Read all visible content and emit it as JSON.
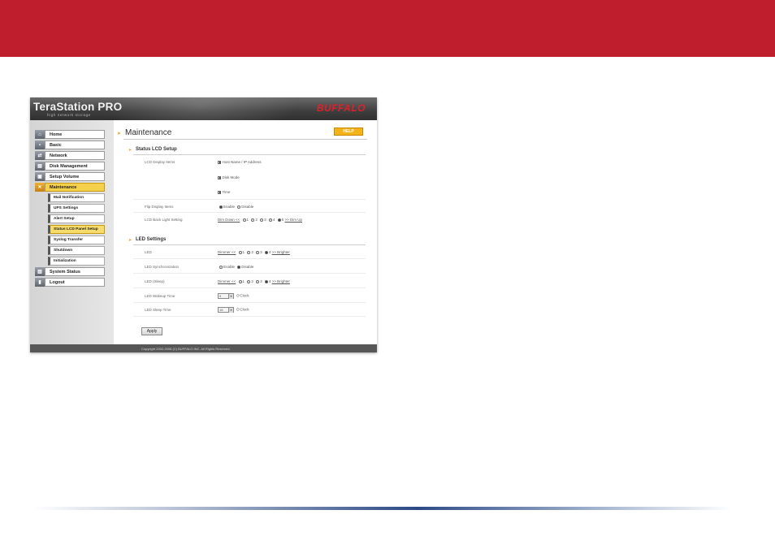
{
  "app": {
    "product_name": "TeraStation PRO",
    "product_sub": "high network storage",
    "brand": "BUFFALO"
  },
  "sidebar": {
    "items": [
      {
        "label": "Home",
        "icon": "home-icon"
      },
      {
        "label": "Basic",
        "icon": "basic-icon"
      },
      {
        "label": "Network",
        "icon": "network-icon"
      },
      {
        "label": "Disk Management",
        "icon": "disk-icon"
      },
      {
        "label": "Setup Volume",
        "icon": "volume-icon"
      },
      {
        "label": "Maintenance",
        "icon": "tools-icon"
      }
    ],
    "sub_items": [
      {
        "label": "Mail Notification"
      },
      {
        "label": "UPS Settings"
      },
      {
        "label": "Alert Setup"
      },
      {
        "label": "Status LCD Panel Setup"
      },
      {
        "label": "Syslog Transfer"
      },
      {
        "label": "Shutdown"
      },
      {
        "label": "Initialization"
      }
    ],
    "bottom_items": [
      {
        "label": "System Status",
        "icon": "status-icon"
      },
      {
        "label": "Logout",
        "icon": "logout-icon"
      }
    ]
  },
  "main": {
    "title": "Maintenance",
    "help_label": "HELP",
    "status_lcd": {
      "heading": "Status LCD Setup",
      "display_items_label": "LCD Display Items",
      "display_items": [
        {
          "label": "Host Name / IP Address",
          "checked": true
        },
        {
          "label": "Disk Mode",
          "checked": true
        },
        {
          "label": "Time",
          "checked": true
        }
      ],
      "flip_label": "Flip Display Items",
      "flip_enable": "Enable",
      "flip_disable": "Disable",
      "flip_selected": "Enable",
      "backlight_label": "LCD Back Light Setting",
      "backlight_prefix": "Dim Down <<",
      "backlight_suffix": ">> Dim Up",
      "backlight_levels": [
        "1",
        "2",
        "3",
        "4",
        "5"
      ],
      "backlight_selected": "5"
    },
    "led": {
      "heading": "LED Settings",
      "led_label": "LED",
      "led_prefix": "Dimmer <<",
      "led_suffix": ">> Brighter",
      "led_levels": [
        "1",
        "2",
        "3",
        "4"
      ],
      "led_selected": "4",
      "sync_label": "LED Synchronization",
      "sync_enable": "Enable",
      "sync_disable": "Disable",
      "sync_selected": "Disable",
      "sleep_label": "LED (Sleep)",
      "sleep_prefix": "Dimmer <<",
      "sleep_suffix": ">> Brighter",
      "sleep_levels": [
        "1",
        "2",
        "3",
        "4"
      ],
      "sleep_selected": "4",
      "wakeup_label": "LED Wakeup Time",
      "wakeup_value": "9",
      "wakeup_unit": "O'Clock",
      "sleep_time_label": "LED Sleep Time",
      "sleep_time_value": "18",
      "sleep_time_unit": "O'Clock"
    },
    "apply_label": "Apply"
  },
  "footer": {
    "copyright": "Copyright 2002-2006 (C) BUFFALO INC. All Rights Reserved."
  },
  "colors": {
    "top_band": "#bf1f2c",
    "active_nav": "#f5d04a",
    "help_button": "#f2b418",
    "brand": "#e0202a"
  }
}
